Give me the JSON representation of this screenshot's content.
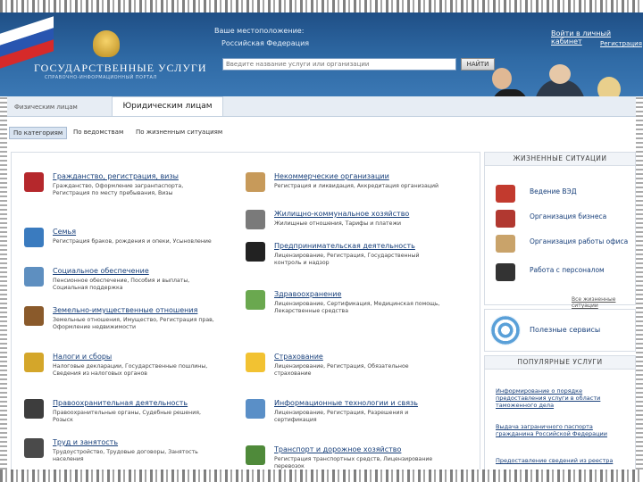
{
  "header": {
    "brand_title": "ГОСУДАРСТВЕННЫЕ УСЛУГИ",
    "brand_subtitle": "СПРАВОЧНО-ИНФОРМАЦИОННЫЙ ПОРТАЛ",
    "location_label": "Ваше местоположение:",
    "location_value": "Российская Федерация",
    "search_placeholder": "Введите название услуги или организации",
    "search_button": "НАЙТИ",
    "login_link": "Войти в личный кабинет",
    "register_link": "Регистрация"
  },
  "tabs": {
    "individuals": "Физическим лицам",
    "legal": "Юридическим лицам"
  },
  "filters": [
    "По категориям",
    "По ведомствам",
    "По жизненным ситуациям"
  ],
  "categories": [
    {
      "title": "Гражданство, регистрация, визы",
      "desc": "Гражданство, Оформление загранпаспорта, Регистрация по месту пребывания, Визы",
      "color": "#b5282c"
    },
    {
      "title": "Семья",
      "desc": "Регистрация браков, рождения и опеки, Усыновление",
      "color": "#3a7bbf"
    },
    {
      "title": "Социальное обеспечение",
      "desc": "Пенсионное обеспечение, Пособия и выплаты, Социальная поддержка",
      "color": "#5e8fc0"
    },
    {
      "title": "Земельно-имущественные отношения",
      "desc": "Земельные отношения, Имущество, Регистрация прав, Оформление недвижимости",
      "color": "#8a5a2b"
    },
    {
      "title": "Налоги и сборы",
      "desc": "Налоговые декларации, Государственные пошлины, Сведения из налоговых органов",
      "color": "#d4a62a"
    },
    {
      "title": "Правоохранительная деятельность",
      "desc": "Правоохранительные органы, Судебные решения, Розыск",
      "color": "#3d3d3d"
    },
    {
      "title": "Труд и занятость",
      "desc": "Трудоустройство, Трудовые договоры, Занятость населения",
      "color": "#4a4a4a"
    },
    {
      "title": "Некоммерческие организации",
      "desc": "Регистрация и ликвидация, Аккредитация организаций",
      "color": "#c79a5a"
    },
    {
      "title": "Жилищно-коммунальное хозяйство",
      "desc": "Жилищные отношения, Тарифы и платежи",
      "color": "#7a7a7a"
    },
    {
      "title": "Предпринимательская деятельность",
      "desc": "Лицензирование, Регистрация, Государственный контроль и надзор",
      "color": "#222222"
    },
    {
      "title": "Здравоохранение",
      "desc": "Лицензирование, Сертификация, Медицинская помощь, Лекарственные средства",
      "color": "#6aa84f"
    },
    {
      "title": "Страхование",
      "desc": "Лицензирование, Регистрация, Обязательное страхование",
      "color": "#f2c232"
    },
    {
      "title": "Информационные технологии и связь",
      "desc": "Лицензирование, Регистрация, Разрешения и сертификация",
      "color": "#5a8fc7"
    },
    {
      "title": "Транспорт и дорожное хозяйство",
      "desc": "Регистрация транспортных средств, Лицензирование перевозок",
      "color": "#4f8a3a"
    }
  ],
  "sidebar": {
    "life_situations_title": "ЖИЗНЕННЫЕ СИТУАЦИИ",
    "life_situations": [
      {
        "label": "Ведение ВЭД",
        "color": "#c23a2e"
      },
      {
        "label": "Организация бизнеса",
        "color": "#b13830"
      },
      {
        "label": "Организация работы офиса",
        "color": "#c9a36a"
      },
      {
        "label": "Работа с персоналом",
        "color": "#333333"
      }
    ],
    "all_situations_link": "Все жизненные ситуации",
    "eservices_label": "Полезные сервисы",
    "popular_title": "ПОПУЛЯРНЫЕ УСЛУГИ",
    "popular": [
      "Информирование о порядке предоставления услуги в области таможенного дела",
      "Выдача заграничного паспорта гражданина Российской Федерации",
      "Предоставление сведений из реестра"
    ]
  }
}
